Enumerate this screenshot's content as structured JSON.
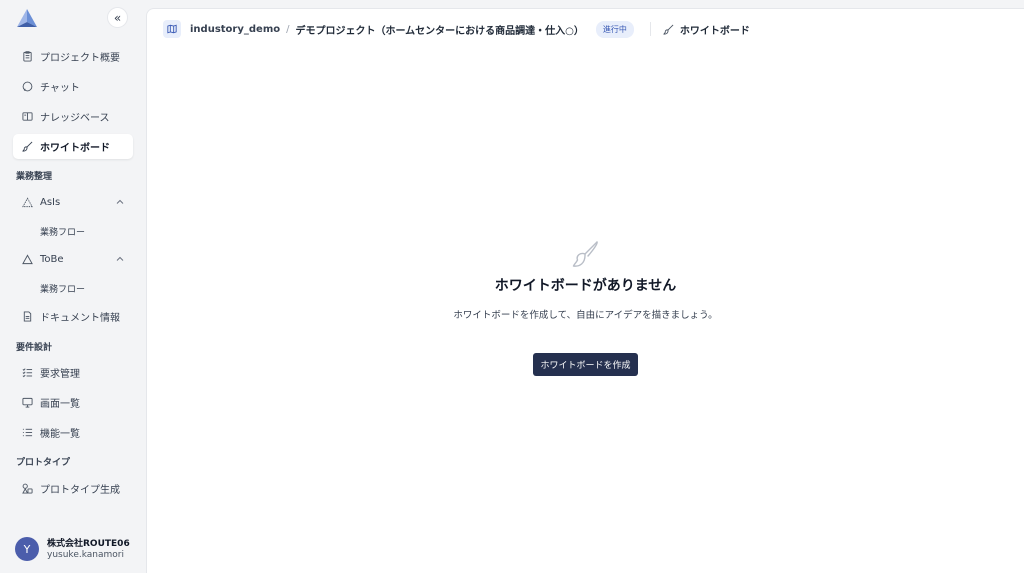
{
  "sidebar": {
    "collapse_label": "«",
    "items": [
      {
        "label": "プロジェクト概要",
        "icon": "clipboard-icon"
      },
      {
        "label": "チャット",
        "icon": "chat-icon"
      },
      {
        "label": "ナレッジベース",
        "icon": "book-icon"
      },
      {
        "label": "ホワイトボード",
        "icon": "brush-icon",
        "active": true
      }
    ],
    "section_business": "業務整理",
    "asis": {
      "label": "AsIs",
      "sub": "業務フロー"
    },
    "tobe": {
      "label": "ToBe",
      "sub": "業務フロー"
    },
    "document": "ドキュメント情報",
    "section_requirements": "要件設計",
    "requirements": "要求管理",
    "screens": "画面一覧",
    "features": "機能一覧",
    "section_prototype": "プロトタイプ",
    "prototype_gen": "プロトタイプ生成",
    "user": {
      "initial": "Y",
      "org": "株式会社ROUTE06",
      "name": "yusuke.kanamori"
    }
  },
  "topbar": {
    "org": "industory_demo",
    "separator": "/",
    "project": "デモプロジェクト（ホームセンターにおける商品調達・仕入○）",
    "status": "進行中",
    "page": "ホワイトボード"
  },
  "empty_state": {
    "title": "ホワイトボードがありません",
    "description": "ホワイトボードを作成して、自由にアイデアを描きましょう。",
    "button": "ホワイトボードを作成"
  },
  "colors": {
    "accent": "#25304f",
    "badge_bg": "#e8eefb",
    "badge_text": "#3b5bb5",
    "avatar": "#4b5dab"
  }
}
